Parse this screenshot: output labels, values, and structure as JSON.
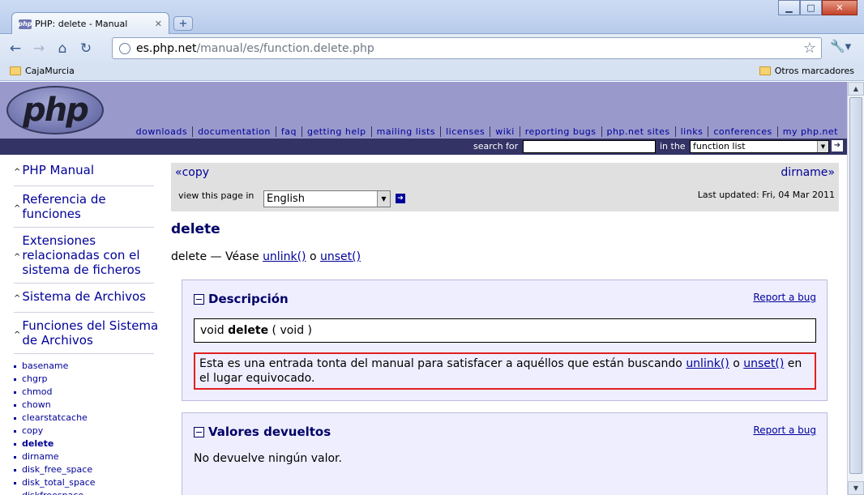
{
  "browser": {
    "tab_title": "PHP: delete - Manual",
    "tab_favicon": "php",
    "url_host": "es.php.net",
    "url_path": "/manual/es/function.delete.php",
    "bookmarks": {
      "left": "CajaMurcia",
      "right": "Otros marcadores"
    }
  },
  "php_header": {
    "logo_text": "php",
    "nav_links": [
      "downloads",
      "documentation",
      "faq",
      "getting help",
      "mailing lists",
      "licenses",
      "wiki",
      "reporting bugs",
      "php.net sites",
      "links",
      "conferences",
      "my php.net"
    ],
    "search_label": "search for",
    "search_value": "",
    "in_the_label": "in the",
    "search_scope": "function list"
  },
  "sidebar": {
    "items": [
      {
        "label": "PHP Manual"
      },
      {
        "label": "Referencia de funciones"
      },
      {
        "label": "Extensiones relacionadas con el sistema de ficheros"
      },
      {
        "label": "Sistema de Archivos"
      },
      {
        "label": "Funciones del Sistema de Archivos"
      }
    ],
    "functions": [
      "basename",
      "chgrp",
      "chmod",
      "chown",
      "clearstatcache",
      "copy",
      "delete",
      "dirname",
      "disk_free_space",
      "disk_total_space",
      "diskfreespace"
    ],
    "current": "delete"
  },
  "main": {
    "prev_label": "copy",
    "next_label": "dirname",
    "view_label": "view this page in",
    "language": "English",
    "last_updated": "Last updated: Fri, 04 Mar 2011",
    "title": "delete",
    "desc_prefix": "delete — Véase",
    "desc_link1": "unlink()",
    "desc_or": "o",
    "desc_link2": "unset()",
    "sections": {
      "description": {
        "title": "Descripción",
        "report": "Report a bug",
        "synopsis_type": "void",
        "synopsis_name": "delete",
        "synopsis_args": "( void )",
        "note_text1": "Esta es una entrada tonta del manual para satisfacer a aquéllos que están buscando",
        "note_link1": "unlink()",
        "note_or": "o",
        "note_link2": "unset()",
        "note_text2": "en el lugar equivocado."
      },
      "return": {
        "title": "Valores devueltos",
        "report": "Report a bug",
        "text": "No devuelve ningún valor."
      }
    }
  },
  "colors": {
    "php_header": "#9999cc",
    "php_searchbar": "#333366",
    "link": "#000099",
    "highlight_border": "#e02020"
  }
}
